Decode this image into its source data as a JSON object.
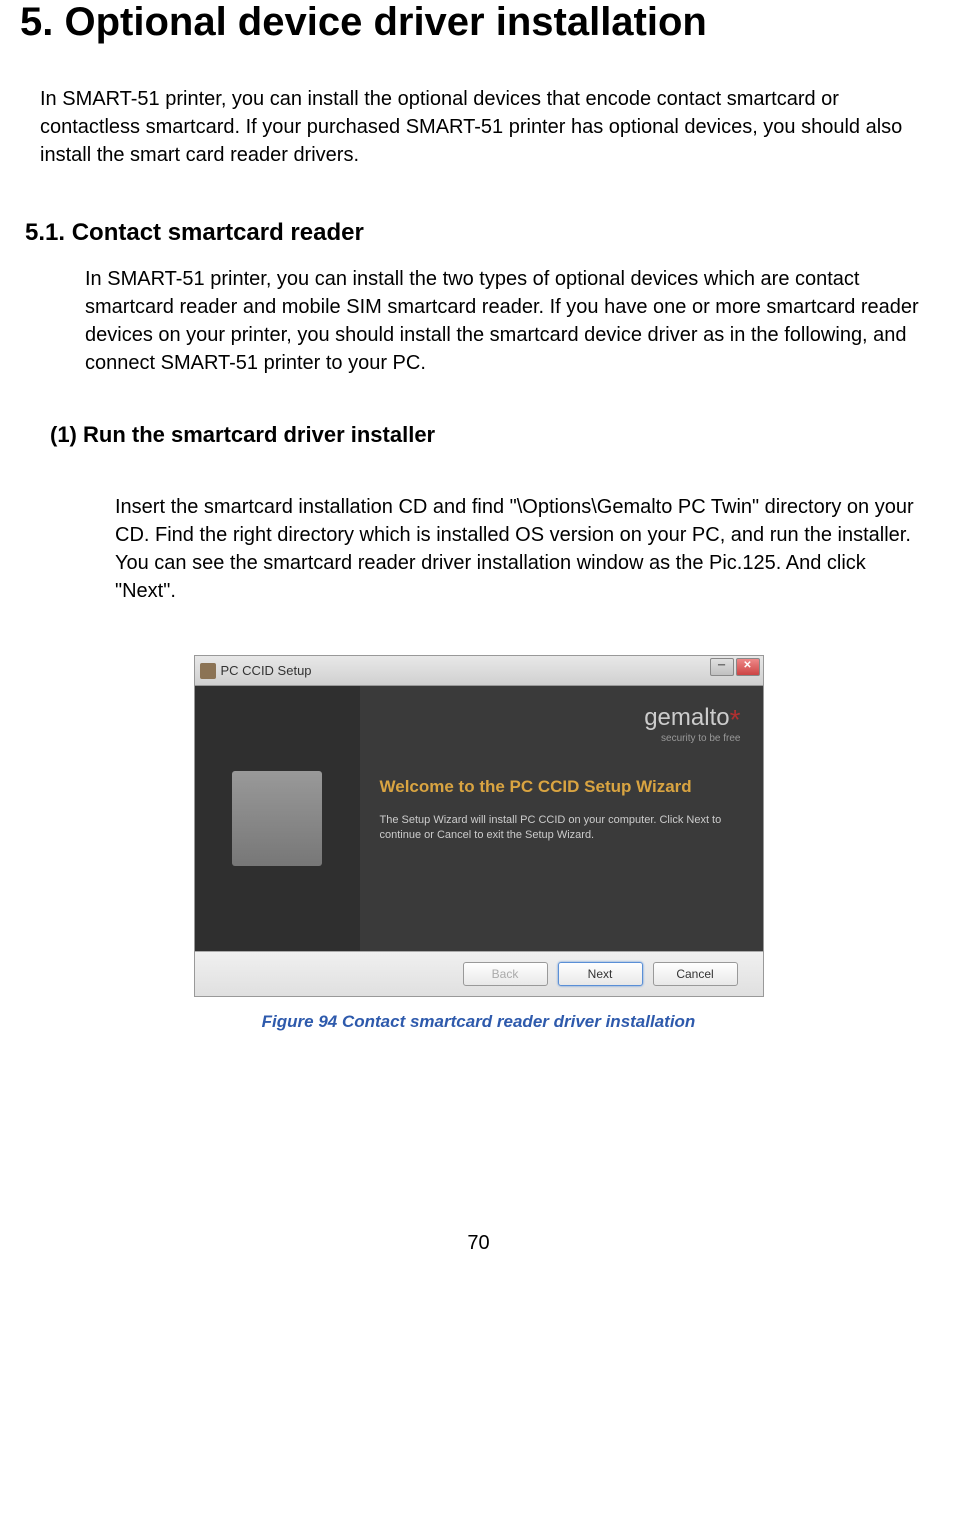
{
  "heading1": "5. Optional device driver installation",
  "intro": "In SMART-51 printer, you can install the optional devices that encode contact smartcard or contactless smartcard. If your purchased SMART-51 printer has optional devices, you should also install the smart card reader drivers.",
  "heading2": "5.1. Contact smartcard reader",
  "section_text": "In SMART-51 printer, you can install the two types of optional devices which are contact smartcard reader and mobile SIM smartcard reader. If you have one or more smartcard reader devices on your printer, you should install the smartcard device driver as in the following, and connect SMART-51 printer to your PC.",
  "heading3": "(1) Run the smartcard driver installer",
  "subsection_text": "Insert the smartcard installation CD and find \"\\Options\\Gemalto PC Twin\" directory on your CD. Find the right directory which is installed OS version on your PC, and run the installer. You can see the smartcard reader driver installation window as the Pic.125. And click \"Next\".",
  "installer": {
    "title": "PC CCID Setup",
    "brand": "gemalto",
    "tagline": "security to be free",
    "welcome_title": "Welcome to the PC CCID Setup Wizard",
    "welcome_desc": "The Setup Wizard will install PC CCID on your computer. Click Next to continue or Cancel to exit the Setup Wizard.",
    "back_label": "Back",
    "next_label": "Next",
    "cancel_label": "Cancel"
  },
  "figure_caption": "Figure 94 Contact smartcard reader driver installation",
  "page_number": "70"
}
